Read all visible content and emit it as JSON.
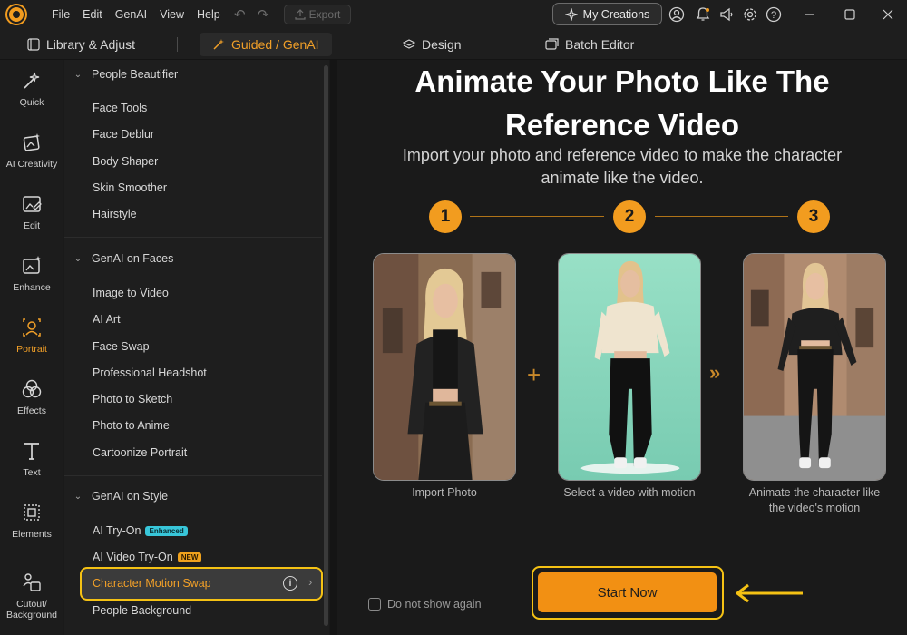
{
  "menu": [
    "File",
    "Edit",
    "GenAI",
    "View",
    "Help"
  ],
  "toolbar": {
    "export_label": "Export",
    "my_creations_label": "My Creations"
  },
  "tabs": [
    {
      "label": "Library & Adjust",
      "icon": "library-icon"
    },
    {
      "label": "Guided / GenAI",
      "icon": "magic-wand-icon",
      "active": true
    },
    {
      "label": "Design",
      "icon": "layers-icon"
    },
    {
      "label": "Batch Editor",
      "icon": "image-stack-icon"
    }
  ],
  "rail": [
    {
      "label": "Quick",
      "icon": "wand-sparkle-icon"
    },
    {
      "label": "AI Creativity",
      "icon": "ai-image-icon"
    },
    {
      "label": "Edit",
      "icon": "edit-image-icon"
    },
    {
      "label": "Enhance",
      "icon": "enhance-image-icon"
    },
    {
      "label": "Portrait",
      "icon": "portrait-icon",
      "active": true
    },
    {
      "label": "Effects",
      "icon": "effects-circles-icon"
    },
    {
      "label": "Text",
      "icon": "text-t-icon"
    },
    {
      "label": "Elements",
      "icon": "elements-grid-icon"
    },
    {
      "label": "Cutout/ Background",
      "icon": "cutout-icon"
    }
  ],
  "sections": [
    {
      "title": "People Beautifier",
      "items": [
        "Face Tools",
        "Face Deblur",
        "Body Shaper",
        "Skin Smoother",
        "Hairstyle"
      ]
    },
    {
      "title": "GenAI on Faces",
      "items": [
        "Image to Video",
        "AI Art",
        "Face Swap",
        "Professional Headshot",
        "Photo to Sketch",
        "Photo to Anime",
        "Cartoonize Portrait"
      ]
    },
    {
      "title": "GenAI on Style",
      "items": [
        {
          "label": "AI Try-On",
          "badge": "Enhanced"
        },
        {
          "label": "AI Video Try-On",
          "badge": "NEW"
        }
      ],
      "selected": "Character Motion Swap",
      "after": "People Background"
    }
  ],
  "main": {
    "title_line1": "Animate Your Photo Like The",
    "title_line2": "Reference Video",
    "subtitle_line1": "Import your photo and reference video to make the character",
    "subtitle_line2": "animate like the video.",
    "steps": [
      "1",
      "2",
      "3"
    ],
    "captions": {
      "c1": "Import Photo",
      "c2": "Select a video with motion",
      "c3_line1": "Animate the character like",
      "c3_line2": "the video's motion"
    },
    "plus_symbol": "+",
    "next_symbol": "»",
    "checkbox_label": "Do not show again",
    "start_label": "Start Now"
  },
  "colors": {
    "accent": "#f29c1f",
    "highlight": "#f5c214",
    "background": "#1a1a1a"
  }
}
